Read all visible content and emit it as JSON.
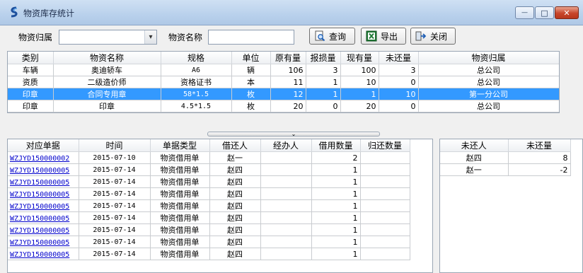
{
  "window": {
    "title": "物资库存统计",
    "min_glyph": "—",
    "max_glyph": "□",
    "close_glyph": "✕"
  },
  "toolbar": {
    "owner_label": "物资归属",
    "owner_value": "",
    "dropdown_arrow": "▾",
    "name_label": "物资名称",
    "name_value": "",
    "query_label": "查询",
    "export_label": "导出",
    "close_label": "关闭"
  },
  "splitter": {
    "glyph": "⌄"
  },
  "inventory": {
    "columns": [
      "类别",
      "物资名称",
      "规格",
      "单位",
      "原有量",
      "报损量",
      "现有量",
      "未还量",
      "物资归属"
    ],
    "rows": [
      [
        "车辆",
        "奥迪轿车",
        "A6",
        "辆",
        "106",
        "3",
        "100",
        "3",
        "总公司"
      ],
      [
        "资质",
        "二级造价师",
        "资格证书",
        "本",
        "11",
        "1",
        "10",
        "0",
        "总公司"
      ],
      [
        "印章",
        "合同专用章",
        "58*1.5",
        "枚",
        "12",
        "1",
        "1",
        "10",
        "第一分公司"
      ],
      [
        "印章",
        "印章",
        "4.5*1.5",
        "枚",
        "20",
        "0",
        "20",
        "0",
        "总公司"
      ]
    ],
    "selected_row": 2
  },
  "loans": {
    "columns": [
      "对应单据",
      "时间",
      "单据类型",
      "借还人",
      "经办人",
      "借用数量",
      "归还数量"
    ],
    "rows": [
      [
        "WZJYD150000002",
        "2015-07-10",
        "物资借用单",
        "赵一",
        "",
        "2",
        ""
      ],
      [
        "WZJYD150000005",
        "2015-07-14",
        "物资借用单",
        "赵四",
        "",
        "1",
        ""
      ],
      [
        "WZJYD150000005",
        "2015-07-14",
        "物资借用单",
        "赵四",
        "",
        "1",
        ""
      ],
      [
        "WZJYD150000005",
        "2015-07-14",
        "物资借用单",
        "赵四",
        "",
        "1",
        ""
      ],
      [
        "WZJYD150000005",
        "2015-07-14",
        "物资借用单",
        "赵四",
        "",
        "1",
        ""
      ],
      [
        "WZJYD150000005",
        "2015-07-14",
        "物资借用单",
        "赵四",
        "",
        "1",
        ""
      ],
      [
        "WZJYD150000005",
        "2015-07-14",
        "物资借用单",
        "赵四",
        "",
        "1",
        ""
      ],
      [
        "WZJYD150000005",
        "2015-07-14",
        "物资借用单",
        "赵四",
        "",
        "1",
        ""
      ],
      [
        "WZJYD150000005",
        "2015-07-14",
        "物资借用单",
        "赵四",
        "",
        "1",
        ""
      ]
    ]
  },
  "outstanding": {
    "columns": [
      "未还人",
      "未还量"
    ],
    "rows": [
      [
        "赵四",
        "8"
      ],
      [
        "赵一",
        "-2"
      ]
    ]
  }
}
